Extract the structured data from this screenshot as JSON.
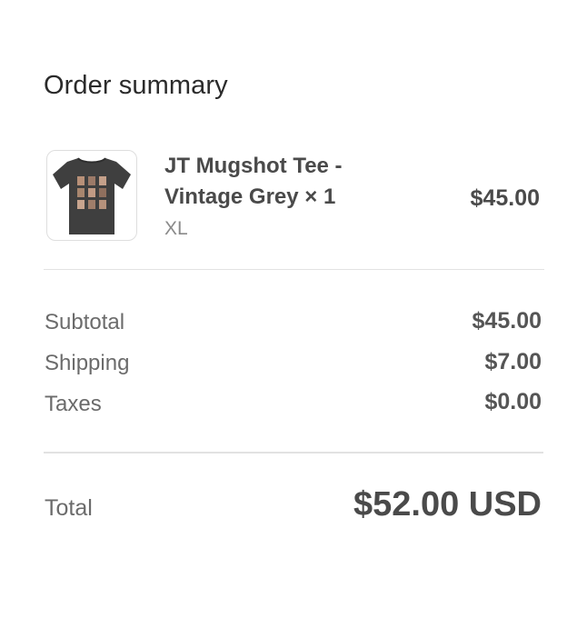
{
  "title": "Order summary",
  "item": {
    "name": "JT Mugshot Tee - Vintage Grey × 1",
    "variant": "XL",
    "price": "$45.00",
    "image_icon": "tshirt-thumbnail"
  },
  "summary": [
    {
      "label": "Subtotal",
      "value": "$45.00"
    },
    {
      "label": "Shipping",
      "value": "$7.00"
    },
    {
      "label": "Taxes",
      "value": "$0.00"
    }
  ],
  "total": {
    "label": "Total",
    "value": "$52.00 USD"
  },
  "colors": {
    "shirt": "#3f3f3f",
    "text": "#4a4a4a",
    "muted": "#8a8a8a",
    "divider": "#e2e2e2"
  }
}
